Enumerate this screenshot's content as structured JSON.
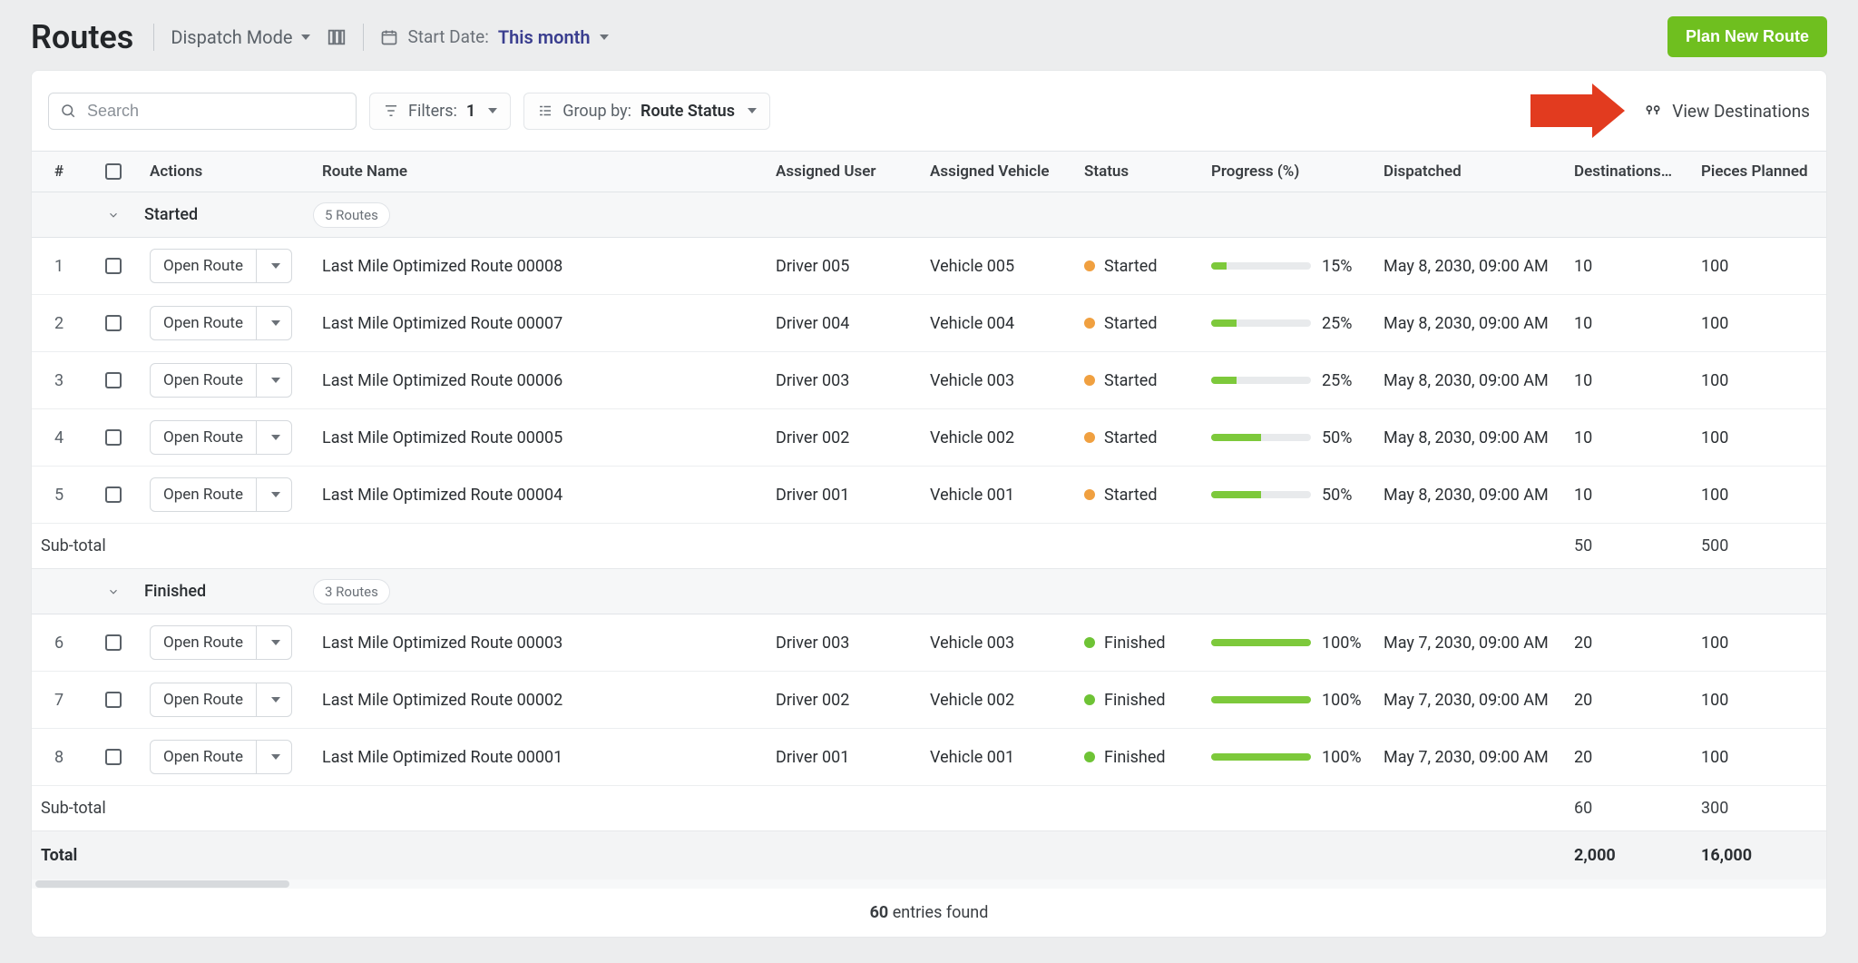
{
  "header": {
    "title": "Routes",
    "mode_label": "Dispatch Mode",
    "start_date_label": "Start Date:",
    "start_date_value": "This month",
    "plan_button": "Plan New Route"
  },
  "toolbar": {
    "search_placeholder": "Search",
    "filters_label": "Filters:",
    "filters_value": "1",
    "group_by_label": "Group by:",
    "group_by_value": "Route Status",
    "view_destinations": "View Destinations"
  },
  "columns": {
    "num": "#",
    "actions": "Actions",
    "route_name": "Route Name",
    "assigned_user": "Assigned User",
    "assigned_vehicle": "Assigned Vehicle",
    "status": "Status",
    "progress": "Progress (%)",
    "dispatched": "Dispatched",
    "destinations": "Destinations…",
    "pieces_planned": "Pieces Planned"
  },
  "labels": {
    "open_route": "Open Route",
    "subtotal": "Sub-total",
    "total": "Total",
    "entries_found": "entries found",
    "entries_count": "60"
  },
  "groups": [
    {
      "name": "Started",
      "badge": "5 Routes",
      "status_color": "orange",
      "rows": [
        {
          "n": "1",
          "name": "Last Mile Optimized Route 00008",
          "user": "Driver 005",
          "vehicle": "Vehicle 005",
          "status": "Started",
          "progress": 15,
          "dispatched": "May 8, 2030, 09:00 AM",
          "dest": "10",
          "pieces": "100"
        },
        {
          "n": "2",
          "name": "Last Mile Optimized Route 00007",
          "user": "Driver 004",
          "vehicle": "Vehicle 004",
          "status": "Started",
          "progress": 25,
          "dispatched": "May 8, 2030, 09:00 AM",
          "dest": "10",
          "pieces": "100"
        },
        {
          "n": "3",
          "name": "Last Mile Optimized Route 00006",
          "user": "Driver 003",
          "vehicle": "Vehicle 003",
          "status": "Started",
          "progress": 25,
          "dispatched": "May 8, 2030, 09:00 AM",
          "dest": "10",
          "pieces": "100"
        },
        {
          "n": "4",
          "name": "Last Mile Optimized Route 00005",
          "user": "Driver 002",
          "vehicle": "Vehicle 002",
          "status": "Started",
          "progress": 50,
          "dispatched": "May 8, 2030, 09:00 AM",
          "dest": "10",
          "pieces": "100"
        },
        {
          "n": "5",
          "name": "Last Mile Optimized Route 00004",
          "user": "Driver 001",
          "vehicle": "Vehicle 001",
          "status": "Started",
          "progress": 50,
          "dispatched": "May 8, 2030, 09:00 AM",
          "dest": "10",
          "pieces": "100"
        }
      ],
      "subtotal": {
        "dest": "50",
        "pieces": "500"
      }
    },
    {
      "name": "Finished",
      "badge": "3 Routes",
      "status_color": "green",
      "rows": [
        {
          "n": "6",
          "name": "Last Mile Optimized Route 00003",
          "user": "Driver 003",
          "vehicle": "Vehicle 003",
          "status": "Finished",
          "progress": 100,
          "dispatched": "May 7, 2030, 09:00 AM",
          "dest": "20",
          "pieces": "100"
        },
        {
          "n": "7",
          "name": "Last Mile Optimized Route 00002",
          "user": "Driver 002",
          "vehicle": "Vehicle 002",
          "status": "Finished",
          "progress": 100,
          "dispatched": "May 7, 2030, 09:00 AM",
          "dest": "20",
          "pieces": "100"
        },
        {
          "n": "8",
          "name": "Last Mile Optimized Route 00001",
          "user": "Driver 001",
          "vehicle": "Vehicle 001",
          "status": "Finished",
          "progress": 100,
          "dispatched": "May 7, 2030, 09:00 AM",
          "dest": "20",
          "pieces": "100"
        }
      ],
      "subtotal": {
        "dest": "60",
        "pieces": "300"
      }
    }
  ],
  "total": {
    "dest": "2,000",
    "pieces": "16,000"
  }
}
